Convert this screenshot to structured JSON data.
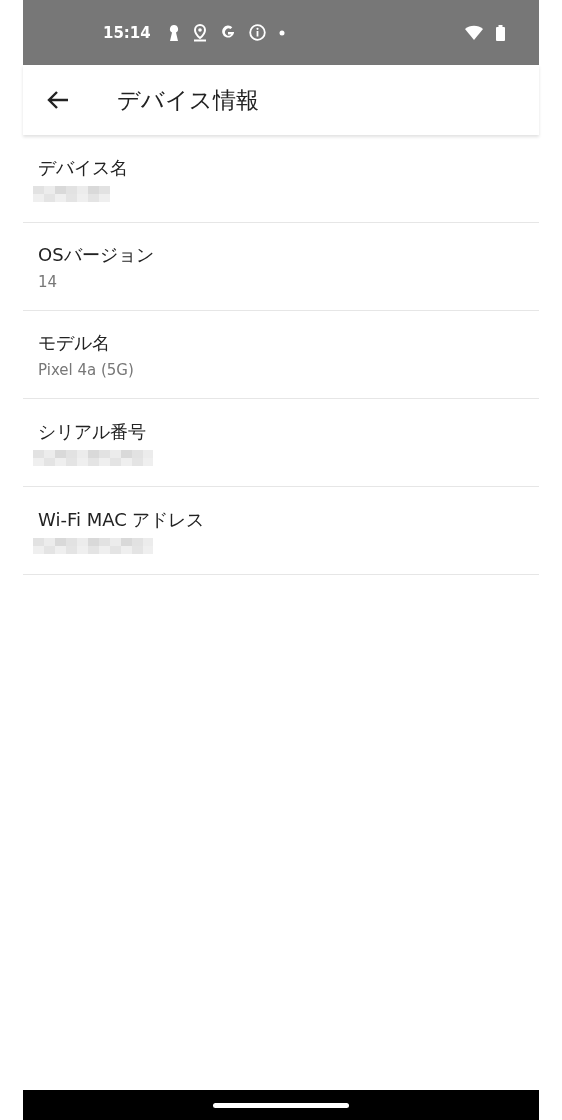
{
  "status_bar": {
    "time": "15:14"
  },
  "app_bar": {
    "title": "デバイス情報"
  },
  "rows": [
    {
      "label": "デバイス名",
      "redacted": true
    },
    {
      "label": "OSバージョン",
      "value": "14",
      "redacted": false
    },
    {
      "label": "モデル名",
      "value": "Pixel 4a (5G)",
      "redacted": false
    },
    {
      "label": "シリアル番号",
      "redacted": true
    },
    {
      "label": "Wi-Fi MAC アドレス",
      "redacted": true
    }
  ]
}
